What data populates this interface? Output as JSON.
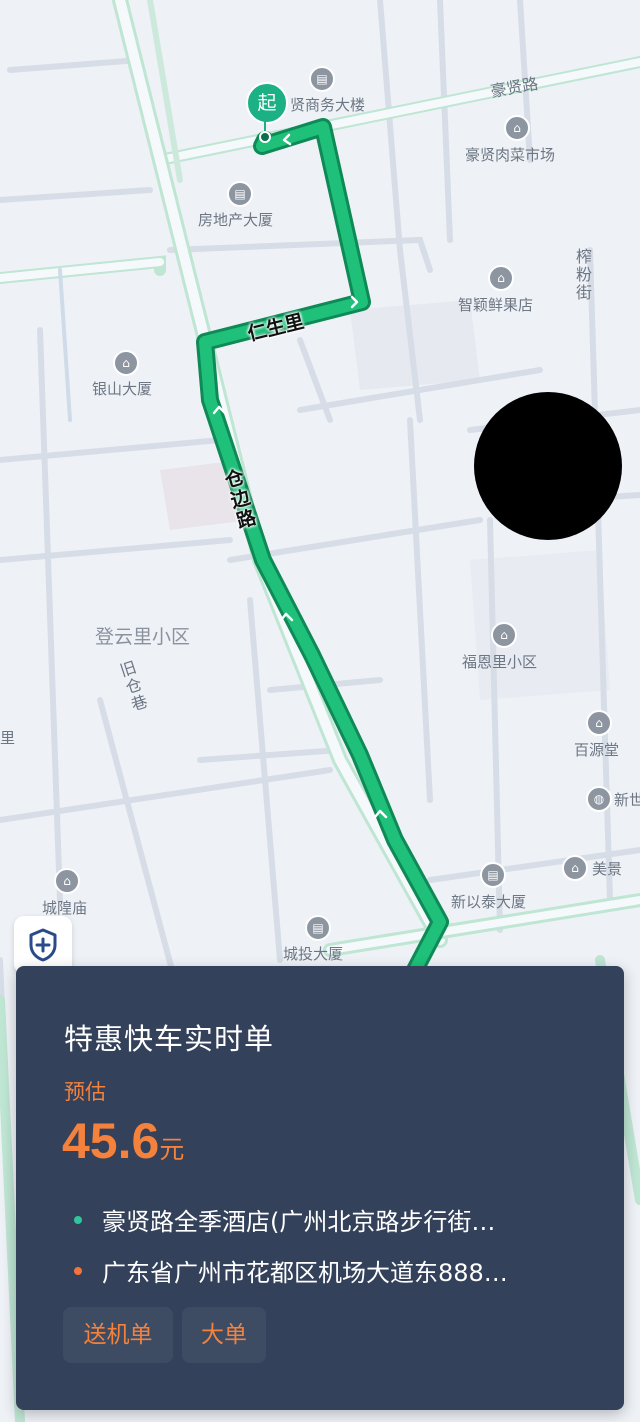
{
  "map": {
    "road_labels": {
      "haoxian_road": "豪贤路",
      "zhafen_street": "榨粉街",
      "jiucang_lane": "旧仓巷"
    },
    "route_labels": {
      "renshengli": "仁生里",
      "cangbian_road": "仓边路"
    },
    "area_labels": {
      "dengyunli": "登云里小区"
    },
    "pois": {
      "haoxian_business": "贤商务大楼",
      "haoxian_market": "豪贤肉菜市场",
      "real_estate": "房地产大厦",
      "zhiying_fruit": "智颖鲜果店",
      "yinshan": "银山大厦",
      "fuenli": "福恩里小区",
      "baiyuantang": "百源堂",
      "xinyitai": "新以泰大厦",
      "meijing": "美景",
      "xin_partial": "新世",
      "chenghuangmiao": "城隍庙",
      "chengtou": "城投大厦",
      "left_li": "里"
    },
    "start_marker": "起",
    "route_color": "#1ec07a"
  },
  "order_card": {
    "title": "特惠快车实时单",
    "estimate_label": "预估",
    "price": "45.6",
    "price_unit": "元",
    "origin": "豪贤路全季酒店(广州北京路步行街…",
    "destination": "广东省广州市花都区机场大道东888…",
    "origin_dot_color": "#2ec79a",
    "destination_dot_color": "#f4723c",
    "tags": [
      "送机单",
      "大单"
    ]
  },
  "safety_button": {
    "icon": "shield-plus-icon"
  }
}
